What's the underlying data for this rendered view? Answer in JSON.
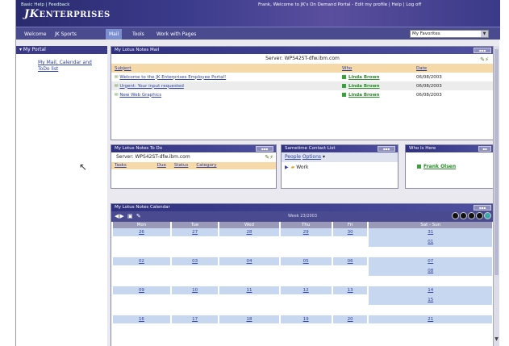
{
  "top": {
    "links": "Basic Help | Feedback",
    "logo_main": "JK",
    "logo_sub": "ENTERPRISES",
    "welcome": "Frank, Welcome to JK's On Demand Portal - Edit my profile | Help | Log off"
  },
  "nav": {
    "tabs": [
      "Welcome",
      "JK Sports",
      "Mail",
      "Tools",
      "Work with Pages"
    ],
    "favorites": "My Favorites"
  },
  "sidebar": {
    "header": "My Portal",
    "item": "My Mail, Calendar and ToDo list"
  },
  "mail": {
    "title": "My Lotus Notes Mail",
    "server": "Server: WPS42ST-dfw.ibm.com",
    "headers": [
      "Subject",
      "Who",
      "Date"
    ],
    "rows": [
      {
        "subject": "Welcome to the JK Enterprises Employee Portal!",
        "who": "Linda Brown",
        "date": "06/08/2003"
      },
      {
        "subject": "Urgent: Your input requested",
        "who": "Linda Brown",
        "date": "06/08/2003"
      },
      {
        "subject": "New Web Graphics",
        "who": "Linda Brown",
        "date": "06/08/2003"
      }
    ]
  },
  "todo": {
    "title": "My Lotus Notes To Do",
    "server": "Server: WPS42ST-dfw.ibm.com",
    "headers": [
      "Tasks",
      "Due",
      "Status",
      "Category"
    ]
  },
  "contacts": {
    "title": "Sametime Contact List",
    "people": "People",
    "options": "Options",
    "group": "Work"
  },
  "whois": {
    "title": "Who Is Here",
    "person": "Frank Olsen"
  },
  "calendar": {
    "title": "My Lotus Notes Calendar",
    "week_label": "Week 23/2003",
    "days": [
      "Mon",
      "Tue",
      "Wed",
      "Thu",
      "Fri",
      "Sat - Sun"
    ],
    "weeks": [
      {
        "dates": [
          "26",
          "27",
          "28",
          "29",
          "30",
          "31"
        ],
        "extra": "01"
      },
      {
        "dates": [
          "02",
          "03",
          "04",
          "05",
          "06",
          "07"
        ],
        "extra": "08"
      },
      {
        "dates": [
          "09",
          "10",
          "11",
          "12",
          "13",
          "14"
        ],
        "extra": "15"
      },
      {
        "dates": [
          "16",
          "17",
          "18",
          "19",
          "20",
          "21"
        ],
        "extra": ""
      }
    ]
  }
}
